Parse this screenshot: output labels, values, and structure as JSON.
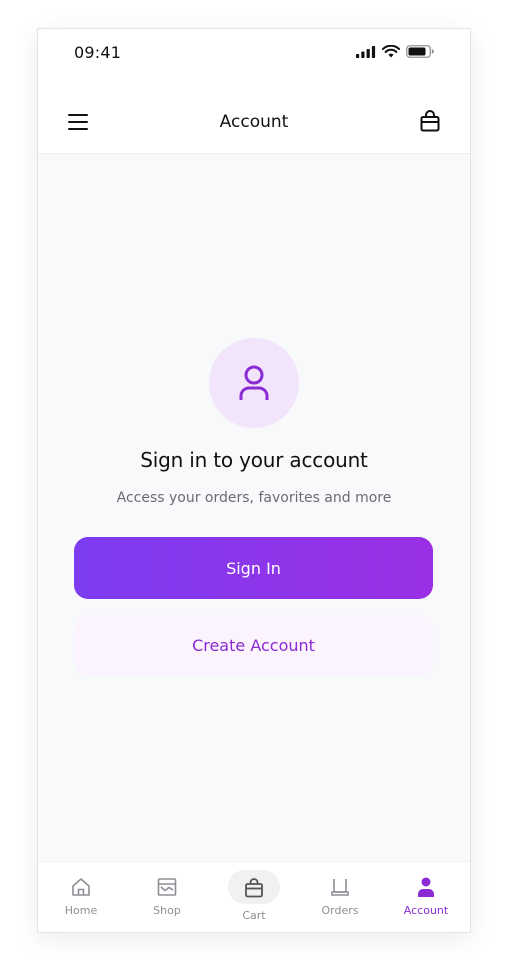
{
  "status_bar": {
    "time": "09:41"
  },
  "header": {
    "title": "Account",
    "menu_icon": "hamburger-menu-icon",
    "bag_icon": "shopping-bag-icon"
  },
  "signin_prompt": {
    "avatar_icon": "user-icon",
    "title": "Sign in to your account",
    "subtitle": "Access your orders, favorites and more",
    "signin_label": "Sign In",
    "create_label": "Create Account"
  },
  "bottom_nav": {
    "items": [
      {
        "label": "Home",
        "icon": "home-icon",
        "active": false
      },
      {
        "label": "Shop",
        "icon": "shop-icon",
        "active": false
      },
      {
        "label": "Cart",
        "icon": "cart-bag-icon",
        "active": false
      },
      {
        "label": "Orders",
        "icon": "receipt-icon",
        "active": false
      },
      {
        "label": "Account",
        "icon": "user-icon",
        "active": true
      }
    ]
  },
  "colors": {
    "accent": "#8a2bd3",
    "gradient_start": "#7d3cf0",
    "gradient_end": "#9a2fe4",
    "avatar_bg": "#f2e5fb",
    "secondary_button_bg": "#fbf3fd",
    "inactive_nav": "#8e8e96"
  }
}
